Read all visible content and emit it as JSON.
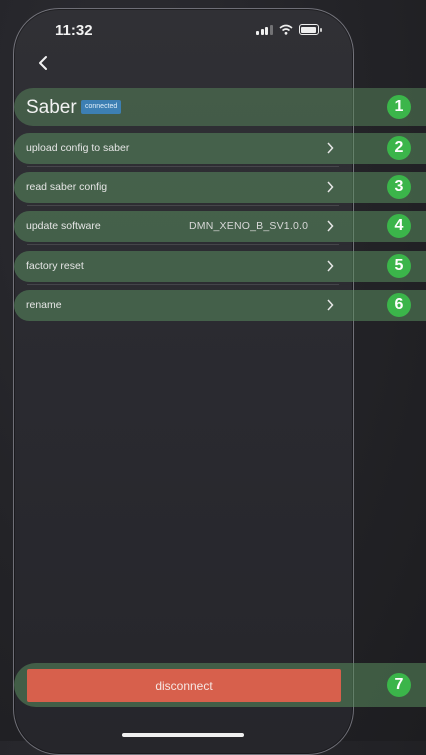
{
  "status_bar": {
    "time": "11:32"
  },
  "device": {
    "name": "Saber",
    "status": "connected"
  },
  "menu": {
    "items": [
      {
        "label": "upload config to saber",
        "value": "",
        "marker": "2"
      },
      {
        "label": "read saber config",
        "value": "",
        "marker": "3"
      },
      {
        "label": "update software",
        "value": "DMN_XENO_B_SV1.0.0",
        "marker": "4"
      },
      {
        "label": "factory reset",
        "value": "",
        "marker": "5"
      },
      {
        "label": "rename",
        "value": "",
        "marker": "6"
      }
    ]
  },
  "header_marker": "1",
  "footer": {
    "disconnect_label": "disconnect",
    "marker": "7"
  },
  "colors": {
    "accent_green": "#3bb54a",
    "disconnect": "#d7604c",
    "badge_blue": "#3d7fb3"
  }
}
